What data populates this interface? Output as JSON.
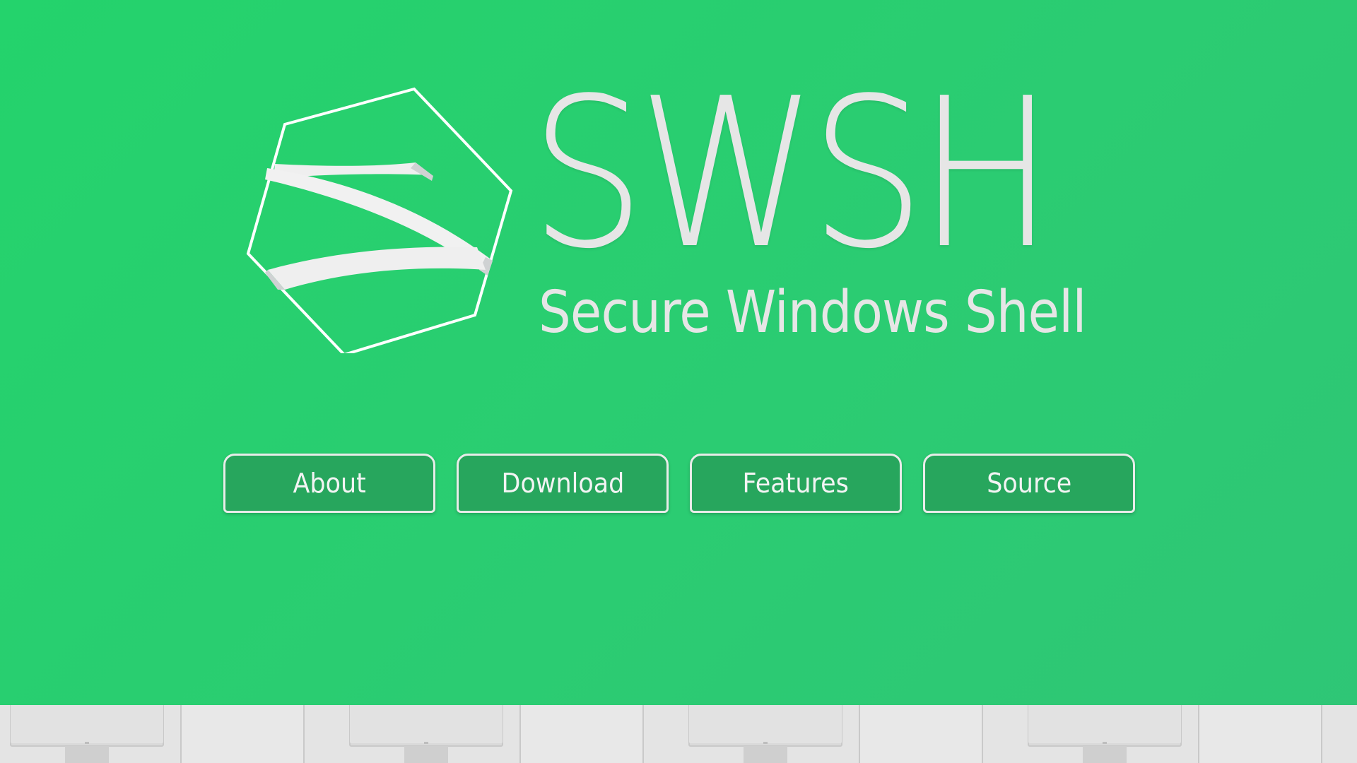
{
  "colors": {
    "background": "#28cf70",
    "button_fill": "#27a65d",
    "button_border": "#e8ece9",
    "text": "#e6e6e6",
    "footer": "#e4e4e4"
  },
  "brand": {
    "logo_icon": "hexagon-swoosh-logo-icon",
    "title": "SWSH",
    "subtitle": "Secure Windows Shell"
  },
  "nav": {
    "buttons": [
      {
        "label": "About"
      },
      {
        "label": "Download"
      },
      {
        "label": "Features"
      },
      {
        "label": "Source"
      }
    ]
  },
  "footer": {
    "decoration_icon": "monitor-icon"
  }
}
